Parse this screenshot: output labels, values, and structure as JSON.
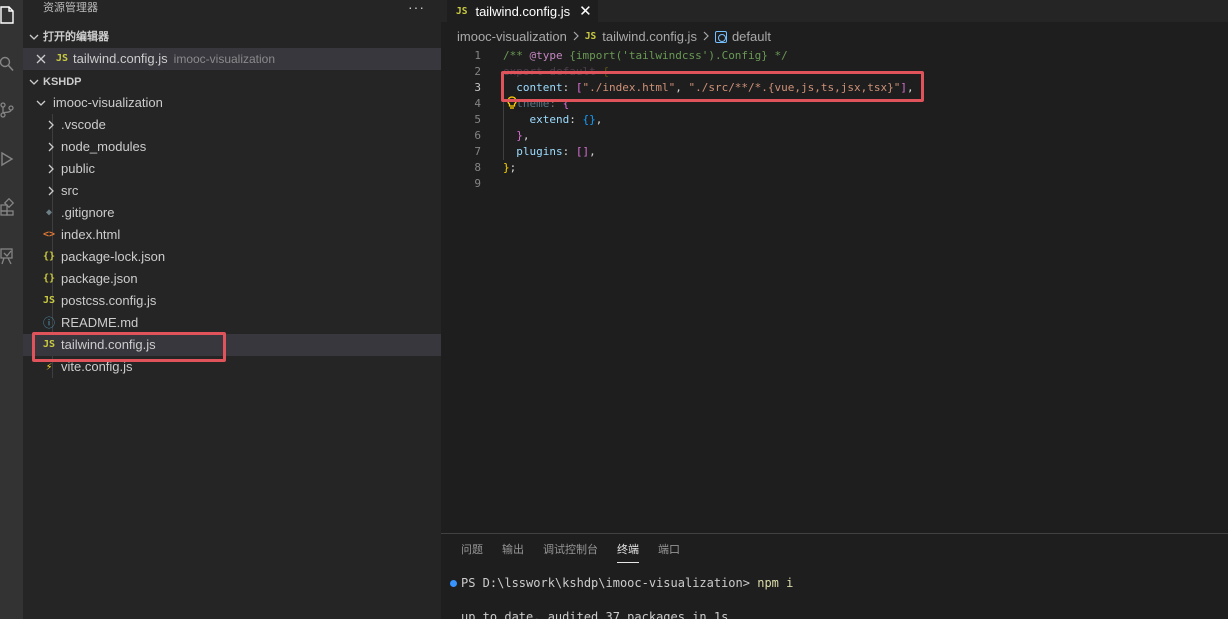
{
  "explorer": {
    "title": "资源管理器",
    "more": "···",
    "open_editors": {
      "header": "打开的编辑器",
      "items": [
        {
          "icon": "JS",
          "label": "tailwind.config.js",
          "description": "imooc-visualization"
        }
      ]
    },
    "workspace": {
      "header": "KSHDP",
      "root": "imooc-visualization",
      "folders": [
        ".vscode",
        "node_modules",
        "public",
        "src"
      ],
      "files": [
        {
          "icon": "git-icon",
          "glyph": "◆",
          "label": ".gitignore"
        },
        {
          "icon": "html-icon",
          "glyph": "<>",
          "label": "index.html"
        },
        {
          "icon": "json-icon",
          "glyph": "{}",
          "label": "package-lock.json"
        },
        {
          "icon": "json-icon",
          "glyph": "{}",
          "label": "package.json"
        },
        {
          "icon": "js-icon",
          "glyph": "JS",
          "label": "postcss.config.js"
        },
        {
          "icon": "info-icon",
          "glyph": "ⓘ",
          "label": "README.md"
        },
        {
          "icon": "js-icon",
          "glyph": "JS",
          "label": "tailwind.config.js"
        },
        {
          "icon": "vite-icon",
          "glyph": "⚡",
          "label": "vite.config.js"
        }
      ],
      "selected": "tailwind.config.js"
    }
  },
  "editor": {
    "tab": {
      "icon": "JS",
      "label": "tailwind.config.js",
      "close": "✕"
    },
    "breadcrumb": [
      "imooc-visualization",
      "tailwind.config.js",
      "default"
    ],
    "breadcrumb_js": "JS",
    "active_line": 3,
    "line_numbers": [
      "1",
      "2",
      "3",
      "4",
      "5",
      "6",
      "7",
      "8",
      "9"
    ],
    "code": {
      "l1_comment_open": "/** ",
      "l1_tag": "@type",
      "l1_rest": " {import('tailwindcss').Config} */",
      "l2_export": "export",
      "l2_default": " default ",
      "l2_brace": "{",
      "l3_prop": "content",
      "l3_colon": ": ",
      "l3_open": "[",
      "l3_s1": "\"./index.html\"",
      "l3_comma": ", ",
      "l3_s2": "\"./src/**/*.{vue,js,ts,jsx,tsx}\"",
      "l3_close": "]",
      "l3_end": ",",
      "l4_prop": "theme",
      "l4_colon": ": ",
      "l4_open": "{",
      "l5_prop": "extend",
      "l5_colon": ": ",
      "l5_val": "{}",
      "l5_end": ",",
      "l6_close": "}",
      "l6_end": ",",
      "l7_prop": "plugins",
      "l7_colon": ": ",
      "l7_val": "[]",
      "l7_end": ",",
      "l8_close": "}",
      "l8_end": ";"
    }
  },
  "panel": {
    "tabs": [
      "问题",
      "输出",
      "调试控制台",
      "终端",
      "端口"
    ],
    "active_tab": "终端",
    "prompt": "PS D:\\lsswork\\kshdp\\imooc-visualization> ",
    "command": "npm i",
    "output": "up to date, audited 37 packages in 1s"
  },
  "colors": {
    "highlight_box": "#e0535a",
    "selection": "#37373d",
    "accent_blue": "#3794ff"
  }
}
